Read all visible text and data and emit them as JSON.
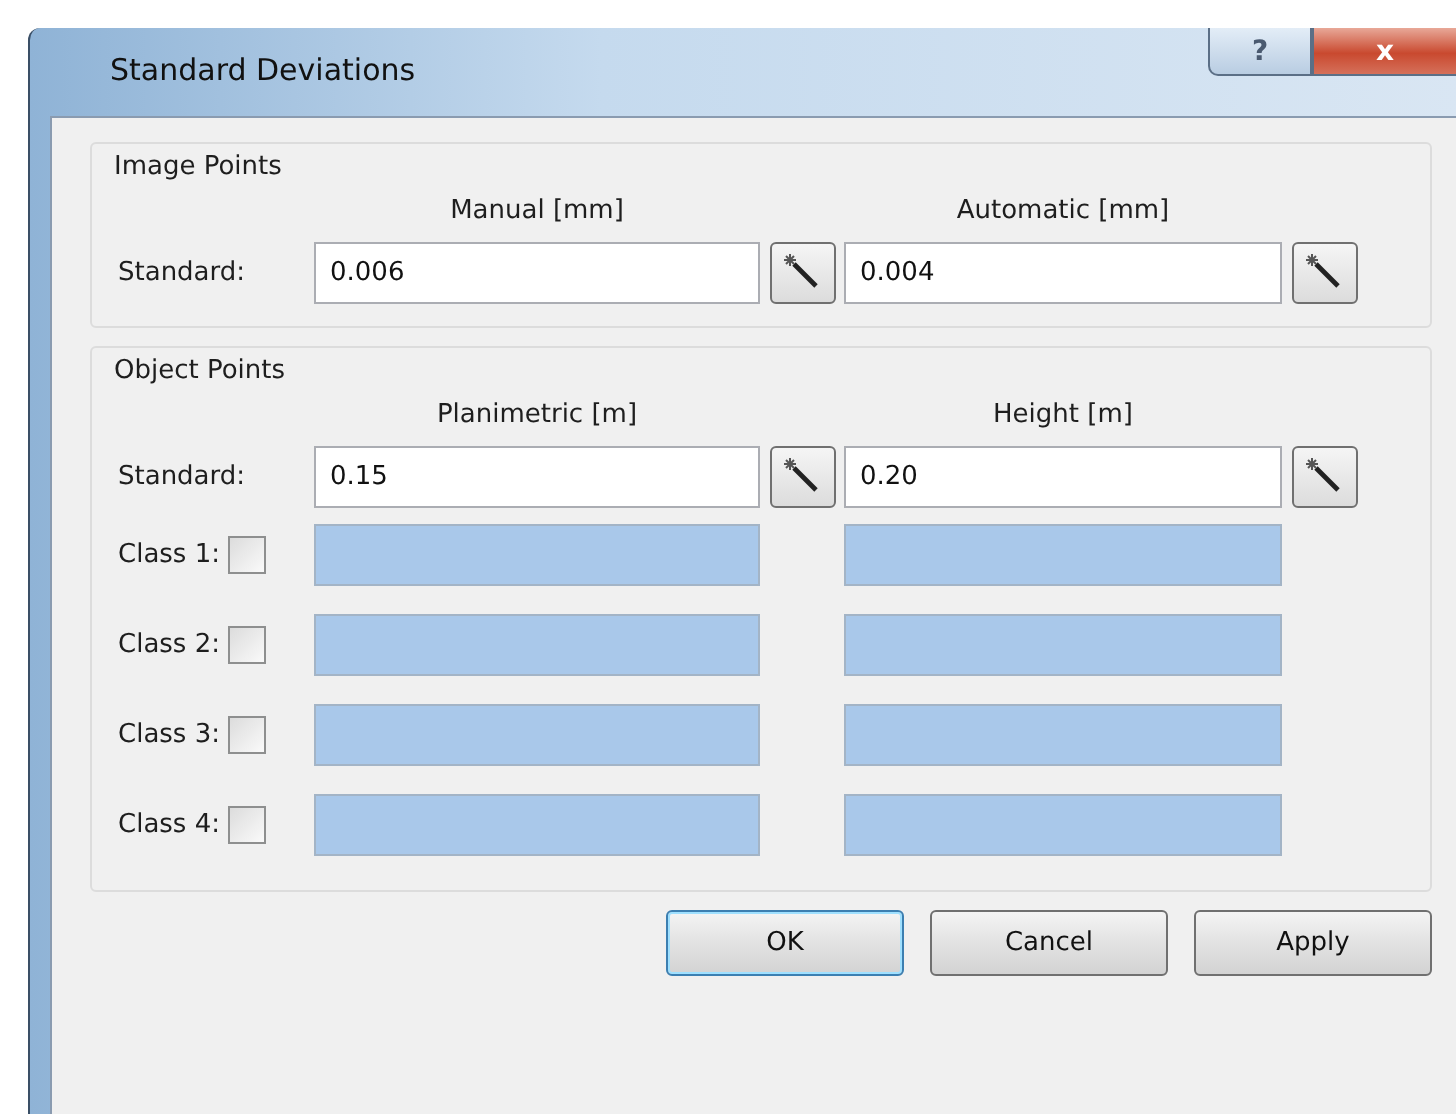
{
  "window": {
    "title": "Standard Deviations",
    "controls": [
      {
        "kind": "help",
        "label": "?"
      },
      {
        "kind": "close",
        "label": "x"
      }
    ]
  },
  "image_points": {
    "title": "Image Points",
    "columns": [
      "Manual [mm]",
      "Automatic [mm]"
    ],
    "standard": {
      "label": "Standard:",
      "values": [
        "0.006",
        "0.004"
      ]
    }
  },
  "object_points": {
    "title": "Object Points",
    "columns": [
      "Planimetric [m]",
      "Height [m]"
    ],
    "standard": {
      "label": "Standard:",
      "values": [
        "0.15",
        "0.20"
      ]
    },
    "classes": [
      {
        "label": "Class 1:",
        "checked": false
      },
      {
        "label": "Class 2:",
        "checked": false
      },
      {
        "label": "Class 3:",
        "checked": false
      },
      {
        "label": "Class 4:",
        "checked": false
      }
    ]
  },
  "buttons": [
    {
      "label": "OK",
      "default": true
    },
    {
      "label": "Cancel",
      "default": false
    },
    {
      "label": "Apply",
      "default": false
    }
  ]
}
